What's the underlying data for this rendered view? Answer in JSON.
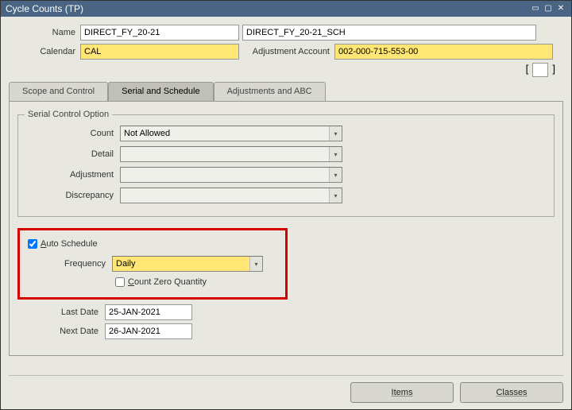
{
  "window": {
    "title": "Cycle Counts (TP)"
  },
  "header": {
    "name_label": "Name",
    "name_value": "DIRECT_FY_20-21",
    "desc_value": "DIRECT_FY_20-21_SCH",
    "calendar_label": "Calendar",
    "calendar_value": "CAL",
    "adj_account_label": "Adjustment Account",
    "adj_account_value": "002-000-715-553-00"
  },
  "tabs": {
    "scope": "Scope and Control",
    "serial": "Serial and Schedule",
    "adjustments": "Adjustments and ABC",
    "active": "serial"
  },
  "serial_control": {
    "legend": "Serial Control Option",
    "count_label": "Count",
    "count_value": "Not Allowed",
    "detail_label": "Detail",
    "detail_value": "",
    "adjustment_label": "Adjustment",
    "adjustment_value": "",
    "discrepancy_label": "Discrepancy",
    "discrepancy_value": ""
  },
  "auto_schedule": {
    "checked": true,
    "label_prefix": "A",
    "label_rest": "uto Schedule",
    "frequency_label": "Frequency",
    "frequency_value": "Daily",
    "count_zero_checked": false,
    "count_zero_prefix": "C",
    "count_zero_rest": "ount Zero Quantity"
  },
  "dates": {
    "last_label": "Last Date",
    "last_value": "25-JAN-2021",
    "next_label": "Next Date",
    "next_value": "26-JAN-2021"
  },
  "footer": {
    "items": "Items",
    "classes": "Classes"
  }
}
